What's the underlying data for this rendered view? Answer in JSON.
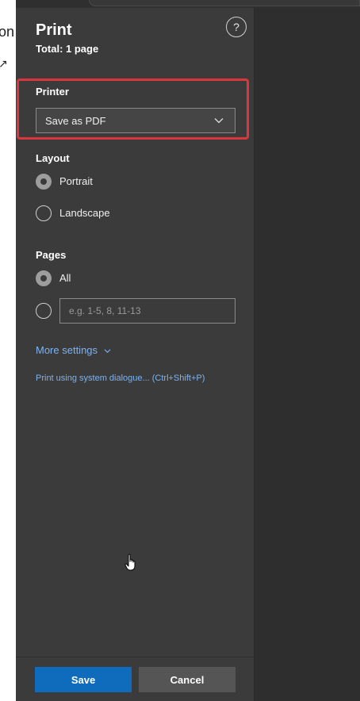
{
  "background_page": {
    "partial_text": "on",
    "partial_mark": "↗"
  },
  "dialog": {
    "title": "Print",
    "subtitle": "Total: 1 page",
    "help_label": "?",
    "help_icon": "question-icon"
  },
  "printer": {
    "label": "Printer",
    "selected": "Save as PDF",
    "highlight_color": "#d9363e"
  },
  "layout": {
    "label": "Layout",
    "options": [
      {
        "label": "Portrait",
        "checked": true
      },
      {
        "label": "Landscape",
        "checked": false
      }
    ]
  },
  "pages": {
    "label": "Pages",
    "all_label": "All",
    "all_checked": true,
    "custom_checked": false,
    "custom_value": "",
    "custom_placeholder": "e.g. 1-5, 8, 11-13"
  },
  "more_settings": {
    "label": "More settings"
  },
  "system_dialog_link": "Print using system dialogue... (Ctrl+Shift+P)",
  "footer": {
    "save_label": "Save",
    "cancel_label": "Cancel"
  },
  "colors": {
    "panel_bg": "#3b3b3b",
    "link": "#7cb3f0",
    "primary_button": "#0f6cbd",
    "secondary_button": "#555555"
  }
}
